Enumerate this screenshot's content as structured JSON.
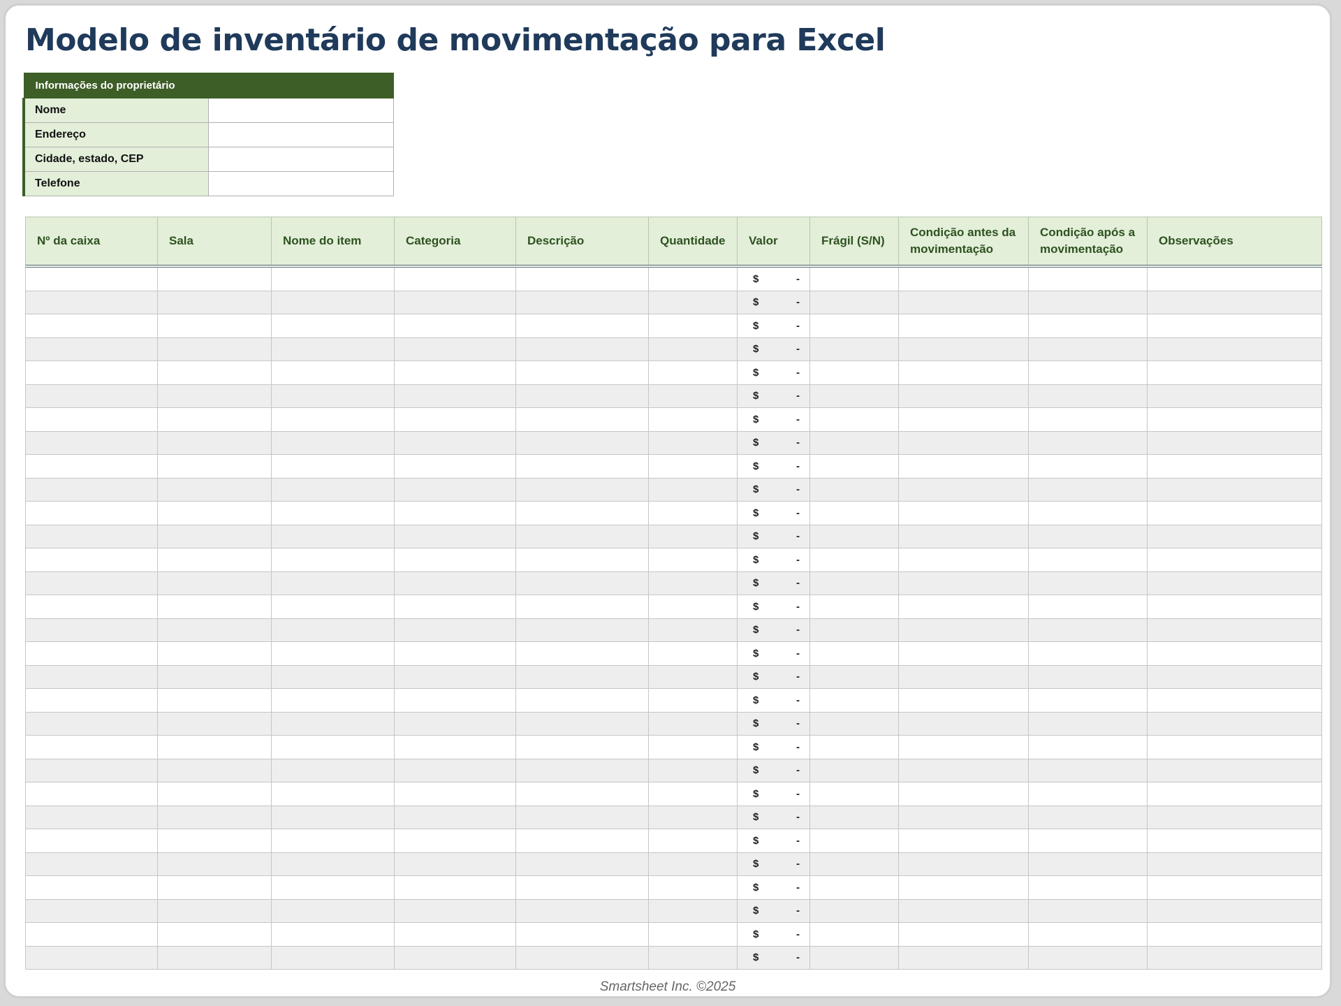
{
  "title": "Modelo de inventário de movimentação para Excel",
  "owner": {
    "header": "Informações do proprietário",
    "fields": [
      {
        "label": "Nome",
        "value": ""
      },
      {
        "label": "Endereço",
        "value": ""
      },
      {
        "label": "Cidade, estado, CEP",
        "value": ""
      },
      {
        "label": "Telefone",
        "value": ""
      }
    ]
  },
  "inventory": {
    "columns": [
      "Nº da caixa",
      "Sala",
      "Nome do item",
      "Categoria",
      "Descrição",
      "Quantidade",
      "Valor",
      "Frágil (S/N)",
      "Condição antes da movimentação",
      "Condição após a movimentação",
      "Observações"
    ],
    "row_count": 30,
    "currency_symbol": "$",
    "empty_value": "-"
  },
  "footer": "Smartsheet Inc. ©2025",
  "colors": {
    "title": "#1f3a5a",
    "owner_header_bg": "#3d5e27",
    "label_bg": "#e3efd9",
    "header_text": "#2e5220",
    "alt_row": "#eeeeee"
  }
}
